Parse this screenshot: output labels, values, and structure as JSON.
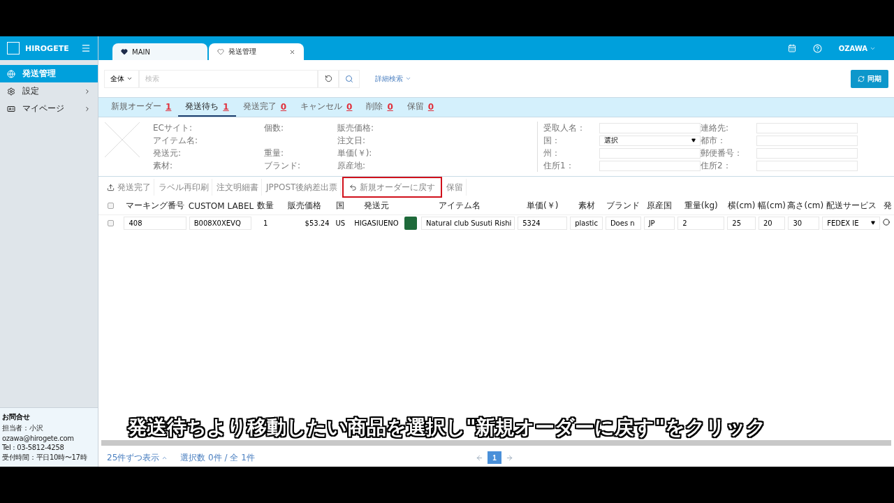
{
  "app": {
    "name": "HIROGETE"
  },
  "tabs": [
    {
      "label": "MAIN",
      "kind": "pinned",
      "selected": false
    },
    {
      "label": "発送管理",
      "kind": "closable",
      "selected": true
    }
  ],
  "user": {
    "name": "OZAWA"
  },
  "sidebar": {
    "items": [
      {
        "label": "発送管理",
        "selected": true,
        "expandable": false
      },
      {
        "label": "設定",
        "selected": false,
        "expandable": true
      },
      {
        "label": "マイページ",
        "selected": false,
        "expandable": true
      }
    ],
    "contact": {
      "title": "お問合せ",
      "lines": [
        "担当者：小沢",
        "ozawa@hirogete.com",
        "Tel : 03-5812-4258",
        "受付時間：平日10時〜17時"
      ]
    }
  },
  "search": {
    "scope": "全体",
    "placeholder": "検索",
    "advanced": "詳細検索",
    "sync_button": "同期"
  },
  "status_tabs": [
    {
      "label": "新規オーダー",
      "count": "1",
      "selected": false
    },
    {
      "label": "発送待ち",
      "count": "1",
      "selected": true
    },
    {
      "label": "発送完了",
      "count": "0",
      "selected": false
    },
    {
      "label": "キャンセル",
      "count": "0",
      "selected": false
    },
    {
      "label": "削除",
      "count": "0",
      "selected": false
    },
    {
      "label": "保留",
      "count": "0",
      "selected": false
    }
  ],
  "product_info": [
    {
      "left": "ECサイト:",
      "middle": "個数:",
      "right": "販売価格:"
    },
    {
      "left": "アイテム名:",
      "right": "注文日:"
    },
    {
      "left": "発送元:",
      "middle": "重量:",
      "right": "単価(￥):"
    },
    {
      "left": "素材:",
      "middle": "ブランド:",
      "right": "原産地:"
    }
  ],
  "recipient_fields": [
    {
      "label": "受取人名：",
      "kind": "input"
    },
    {
      "label": "連絡先:",
      "kind": "input"
    },
    {
      "label": "国：",
      "kind": "select",
      "value": "選択"
    },
    {
      "label": "都市：",
      "kind": "input"
    },
    {
      "label": "州：",
      "kind": "input"
    },
    {
      "label": "郵便番号：",
      "kind": "input"
    },
    {
      "label": "住所1：",
      "kind": "input"
    },
    {
      "label": "住所2：",
      "kind": "input"
    }
  ],
  "actions": [
    {
      "label": "発送完了",
      "highlighted": false
    },
    {
      "label": "ラベル再印刷",
      "highlighted": false
    },
    {
      "label": "注文明細書",
      "highlighted": false
    },
    {
      "label": "JPPOST後納差出票",
      "highlighted": false
    },
    {
      "label": "新規オーダーに戻す",
      "highlighted": true
    },
    {
      "label": "保留",
      "highlighted": false
    }
  ],
  "table": {
    "all_checked": false,
    "columns": [
      "マーキング番号",
      "CUSTOM LABEL",
      "数量",
      "販売価格",
      "国",
      "発送元",
      "アイテム名",
      "単価(￥)",
      "素材",
      "ブランド",
      "原産国",
      "重量(kg)",
      "横(cm)",
      "幅(cm)",
      "高さ(cm)",
      "配送サービス",
      "発"
    ],
    "rows": [
      {
        "checked": false,
        "cells": [
          {
            "kind": "input",
            "text": "408"
          },
          {
            "kind": "input",
            "text": "B008X0XEVQ"
          },
          {
            "kind": "text",
            "text": "1"
          },
          {
            "kind": "price",
            "text": "$53.24"
          },
          {
            "kind": "text",
            "text": "US"
          },
          {
            "kind": "text",
            "text": "HIGASIUENO"
          },
          {
            "kind": "item",
            "text": "Natural club Susuti Rishi"
          },
          {
            "kind": "input",
            "text": "5324"
          },
          {
            "kind": "input",
            "text": "plastic"
          },
          {
            "kind": "input",
            "text": "Does n"
          },
          {
            "kind": "input",
            "text": "JP"
          },
          {
            "kind": "input",
            "text": "2"
          },
          {
            "kind": "input",
            "text": "25"
          },
          {
            "kind": "input",
            "text": "20"
          },
          {
            "kind": "input",
            "text": "30"
          },
          {
            "kind": "select",
            "text": "FEDEX IE"
          },
          {
            "kind": "radio"
          }
        ]
      }
    ]
  },
  "footer": {
    "page_size": "25件ずつ表示",
    "selection": "選択数 0件 / 全 1件",
    "pages": [
      {
        "label": "1",
        "selected": true
      }
    ]
  },
  "caption": "発送待ちより移動したい商品を選択し\"新規オーダーに戻す\"をクリック"
}
